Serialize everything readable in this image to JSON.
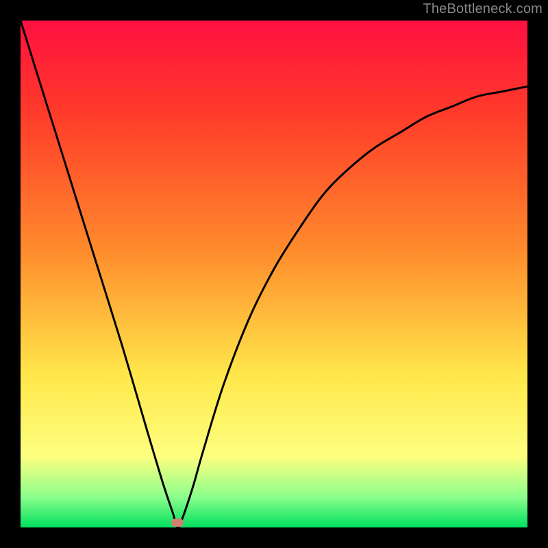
{
  "attribution": "TheBottleneck.com",
  "colors": {
    "black": "#000000",
    "red_top": "#FF1040",
    "red_mid": "#FF3A2A",
    "orange": "#FF8A2C",
    "yellow": "#FFE74A",
    "yellow_light": "#FEFF80",
    "green_light": "#8CFF8C",
    "green": "#00E060",
    "curve_stroke": "#000000",
    "marker_fill": "#D08070",
    "attribution_text": "#888888"
  },
  "plot": {
    "x_range": [
      0,
      100
    ],
    "y_range": [
      0,
      100
    ],
    "minimum_x_pct": 31,
    "marker": {
      "x_pct": 31,
      "y_pct": 99
    }
  },
  "chart_data": {
    "type": "line",
    "title": "",
    "xlabel": "",
    "ylabel": "",
    "xlim": [
      0,
      100
    ],
    "ylim": [
      0,
      100
    ],
    "series": [
      {
        "name": "bottleneck-curve",
        "x": [
          0,
          5,
          10,
          15,
          20,
          25,
          28,
          30,
          31,
          32,
          34,
          36,
          40,
          45,
          50,
          55,
          60,
          65,
          70,
          75,
          80,
          85,
          90,
          95,
          100
        ],
        "y": [
          100,
          84,
          68,
          52,
          36,
          19,
          9,
          3,
          0,
          2,
          8,
          15,
          28,
          41,
          51,
          59,
          66,
          71,
          75,
          78,
          81,
          83,
          85,
          86,
          87
        ]
      }
    ],
    "markers": [
      {
        "name": "optimal-point",
        "x": 31,
        "y": 0,
        "color": "#D08070"
      }
    ],
    "background_gradient_stops": [
      {
        "pct": 0,
        "color": "#FF1040"
      },
      {
        "pct": 18,
        "color": "#FF3A2A"
      },
      {
        "pct": 45,
        "color": "#FF8A2C"
      },
      {
        "pct": 70,
        "color": "#FFE74A"
      },
      {
        "pct": 86,
        "color": "#FEFF80"
      },
      {
        "pct": 94,
        "color": "#8CFF8C"
      },
      {
        "pct": 100,
        "color": "#00E060"
      }
    ]
  }
}
